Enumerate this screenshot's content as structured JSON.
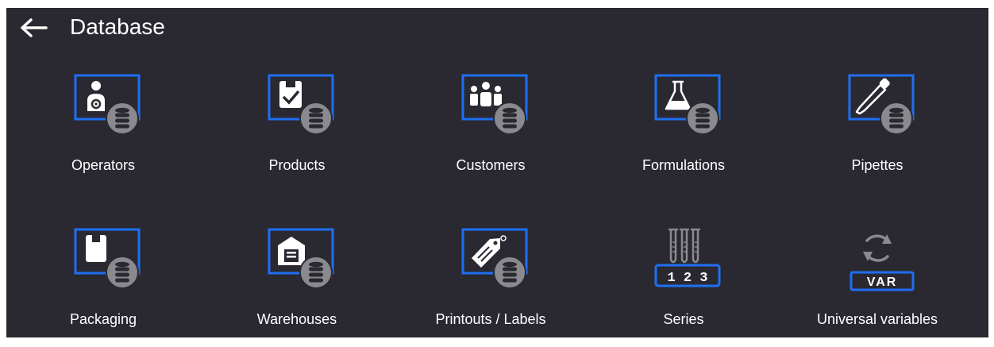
{
  "header": {
    "title": "Database"
  },
  "tiles": [
    {
      "label": "Operators",
      "icon": "operator-database-icon"
    },
    {
      "label": "Products",
      "icon": "product-database-icon"
    },
    {
      "label": "Customers",
      "icon": "customers-database-icon"
    },
    {
      "label": "Formulations",
      "icon": "formulations-database-icon"
    },
    {
      "label": "Pipettes",
      "icon": "pipette-database-icon"
    },
    {
      "label": "Packaging",
      "icon": "packaging-database-icon"
    },
    {
      "label": "Warehouses",
      "icon": "warehouse-database-icon"
    },
    {
      "label": "Printouts / Labels",
      "icon": "label-database-icon"
    },
    {
      "label": "Series",
      "icon": "test-tubes-series-icon",
      "badge": "1 2 3"
    },
    {
      "label": "Universal variables",
      "icon": "refresh-var-icon",
      "badge": "VAR"
    }
  ],
  "colors": {
    "background": "#2a2932",
    "accent": "#1f6ff2",
    "icon": "#ffffff",
    "database": "#8a8a8e"
  }
}
